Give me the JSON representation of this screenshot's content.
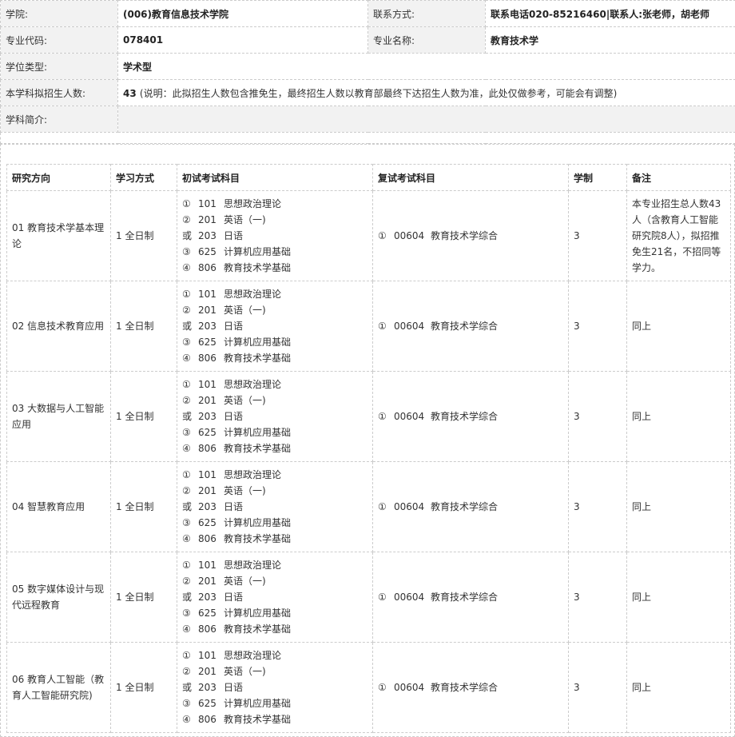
{
  "info": {
    "school_label": "学院:",
    "school_value": "(006)教育信息技术学院",
    "contact_label": "联系方式:",
    "contact_value": "联系电话020-85216460|联系人:张老师，胡老师",
    "major_code_label": "专业代码:",
    "major_code_value": "078401",
    "major_name_label": "专业名称:",
    "major_name_value": "教育技术学",
    "degree_label": "学位类型:",
    "degree_value": "学术型",
    "quota_label": "本学科拟招生人数:",
    "quota_value": "43",
    "quota_note": "(说明：此拟招生人数包含推免生，最终招生人数以教育部最终下达招生人数为准，此处仅做参考，可能会有调整)",
    "intro_label": "学科简介:"
  },
  "table": {
    "headers": [
      "研究方向",
      "学习方式",
      "初试考试科目",
      "复试考试科目",
      "学制",
      "备注"
    ],
    "rows": [
      {
        "direction": "01 教育技术学基本理论",
        "mode": "1 全日制",
        "subjects": [
          {
            "mark": "①",
            "code": "101",
            "name": "思想政治理论"
          },
          {
            "mark": "②",
            "code": "201",
            "name": "英语（一)"
          },
          {
            "mark": "或",
            "code": "203",
            "name": "日语"
          },
          {
            "mark": "③",
            "code": "625",
            "name": "计算机应用基础"
          },
          {
            "mark": "④",
            "code": "806",
            "name": "教育技术学基础"
          }
        ],
        "retest": {
          "mark": "①",
          "code": "00604",
          "name": "教育技术学综合"
        },
        "years": "3",
        "remark": "本专业招生总人数43人（含教育人工智能研究院8人），拟招推免生21名，不招同等学力。"
      },
      {
        "direction": "02 信息技术教育应用",
        "mode": "1 全日制",
        "subjects": [
          {
            "mark": "①",
            "code": "101",
            "name": "思想政治理论"
          },
          {
            "mark": "②",
            "code": "201",
            "name": "英语（一)"
          },
          {
            "mark": "或",
            "code": "203",
            "name": "日语"
          },
          {
            "mark": "③",
            "code": "625",
            "name": "计算机应用基础"
          },
          {
            "mark": "④",
            "code": "806",
            "name": "教育技术学基础"
          }
        ],
        "retest": {
          "mark": "①",
          "code": "00604",
          "name": "教育技术学综合"
        },
        "years": "3",
        "remark": "同上"
      },
      {
        "direction": "03 大数据与人工智能应用",
        "mode": "1 全日制",
        "subjects": [
          {
            "mark": "①",
            "code": "101",
            "name": "思想政治理论"
          },
          {
            "mark": "②",
            "code": "201",
            "name": "英语（一)"
          },
          {
            "mark": "或",
            "code": "203",
            "name": "日语"
          },
          {
            "mark": "③",
            "code": "625",
            "name": "计算机应用基础"
          },
          {
            "mark": "④",
            "code": "806",
            "name": "教育技术学基础"
          }
        ],
        "retest": {
          "mark": "①",
          "code": "00604",
          "name": "教育技术学综合"
        },
        "years": "3",
        "remark": "同上"
      },
      {
        "direction": "04 智慧教育应用",
        "mode": "1 全日制",
        "subjects": [
          {
            "mark": "①",
            "code": "101",
            "name": "思想政治理论"
          },
          {
            "mark": "②",
            "code": "201",
            "name": "英语（一)"
          },
          {
            "mark": "或",
            "code": "203",
            "name": "日语"
          },
          {
            "mark": "③",
            "code": "625",
            "name": "计算机应用基础"
          },
          {
            "mark": "④",
            "code": "806",
            "name": "教育技术学基础"
          }
        ],
        "retest": {
          "mark": "①",
          "code": "00604",
          "name": "教育技术学综合"
        },
        "years": "3",
        "remark": "同上"
      },
      {
        "direction": "05 数字媒体设计与现代远程教育",
        "mode": "1 全日制",
        "subjects": [
          {
            "mark": "①",
            "code": "101",
            "name": "思想政治理论"
          },
          {
            "mark": "②",
            "code": "201",
            "name": "英语（一)"
          },
          {
            "mark": "或",
            "code": "203",
            "name": "日语"
          },
          {
            "mark": "③",
            "code": "625",
            "name": "计算机应用基础"
          },
          {
            "mark": "④",
            "code": "806",
            "name": "教育技术学基础"
          }
        ],
        "retest": {
          "mark": "①",
          "code": "00604",
          "name": "教育技术学综合"
        },
        "years": "3",
        "remark": "同上"
      },
      {
        "direction": "06 教育人工智能（教育人工智能研究院)",
        "mode": "1 全日制",
        "subjects": [
          {
            "mark": "①",
            "code": "101",
            "name": "思想政治理论"
          },
          {
            "mark": "②",
            "code": "201",
            "name": "英语（一)"
          },
          {
            "mark": "或",
            "code": "203",
            "name": "日语"
          },
          {
            "mark": "③",
            "code": "625",
            "name": "计算机应用基础"
          },
          {
            "mark": "④",
            "code": "806",
            "name": "教育技术学基础"
          }
        ],
        "retest": {
          "mark": "①",
          "code": "00604",
          "name": "教育技术学综合"
        },
        "years": "3",
        "remark": "同上"
      }
    ]
  }
}
